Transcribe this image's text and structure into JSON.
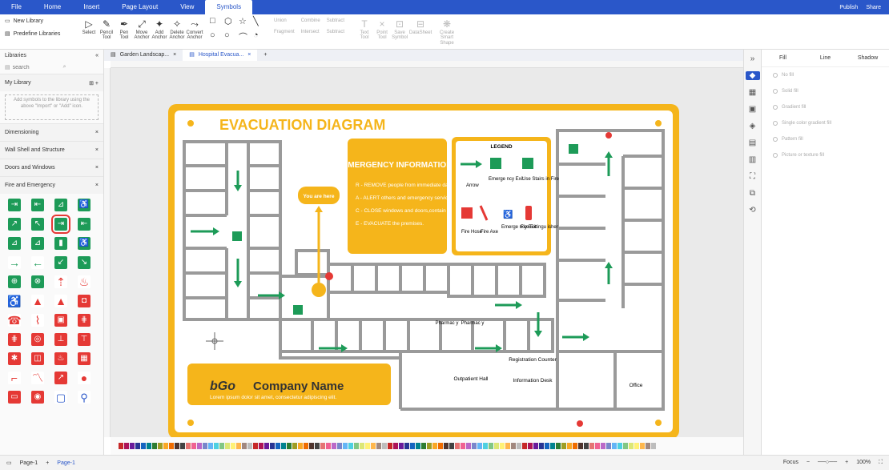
{
  "menubar": {
    "items": [
      "File",
      "Home",
      "Insert",
      "Page Layout",
      "View",
      "Symbols"
    ],
    "publish": "Publish",
    "share": "Share"
  },
  "ribbon": {
    "new_library": "New Library",
    "predefine": "Predefine Libraries",
    "tools": [
      {
        "icon": "▷",
        "label": "Select"
      },
      {
        "icon": "✎",
        "label": "Pencil Tool"
      },
      {
        "icon": "✒",
        "label": "Pen Tool"
      },
      {
        "icon": "⤢",
        "label": "Move Anchor"
      },
      {
        "icon": "✦",
        "label": "Add Anchor"
      },
      {
        "icon": "✧",
        "label": "Delete Anchor"
      },
      {
        "icon": "⤳",
        "label": "Convert Anchor"
      }
    ],
    "shapes": [
      "□",
      "⬡",
      "☆",
      "╲",
      "○",
      "○",
      "⌒",
      "◔"
    ],
    "union": "Union",
    "combine": "Combine",
    "subtract": "Subtract",
    "fragment": "Fragment",
    "intersect": "Intersect",
    "subtract2": "Subtract",
    "tools2": [
      {
        "icon": "T",
        "label": "Text Tool"
      },
      {
        "icon": "×",
        "label": "Point Tool"
      },
      {
        "icon": "⊡",
        "label": "Save Symbol"
      },
      {
        "icon": "⊟",
        "label": "DataSheet"
      },
      {
        "icon": "❋",
        "label": "Create Smart Shape"
      }
    ]
  },
  "sidebar": {
    "title": "Libraries",
    "search_placeholder": "search",
    "my_library": "My Library",
    "empty_hint": "Add symbols to the library using the above \"Import\" or \"Add\" icon.",
    "sections": [
      "Dimensioning",
      "Wall Shell and Structure",
      "Doors and Windows",
      "Fire and Emergency"
    ]
  },
  "tabs": [
    {
      "label": "Garden Landscap..."
    },
    {
      "label": "Hospital Evacua..."
    }
  ],
  "diagram": {
    "title": "EVACUATION DIAGRAM",
    "you_are_here": "You are here",
    "emergency_title": "EMERGENCY INFORMATION",
    "emergency_lines": [
      "R - REMOVE people from immediate danger.",
      "A - ALERT others and emergency services.",
      "C - CLOSE windows and doors,contain the spread of fire.",
      "E - EVACUATE the premises."
    ],
    "legend_title": "LEGEND",
    "legend_items": [
      "Arrow",
      "Emerge ncy Exit",
      "Use Stairs in Fire",
      "Fire Hose",
      "Fire Axe",
      "Emerge ncy Exit",
      "Fire Extingu isher"
    ],
    "company": "Company Name",
    "company_sub": "Lorem ipsum dolor sit amet, consectetur adipiscing elit.",
    "rooms": {
      "pharmacy1": "Pharmac y",
      "pharmacy2": "Pharmac y",
      "registration": "Registration Counter",
      "info": "Information Desk",
      "outpatient": "Outpatient Hall",
      "office": "Office"
    },
    "logo": "bGo"
  },
  "fill_panel": {
    "tabs": [
      "Fill",
      "Line",
      "Shadow"
    ],
    "options": [
      "No fill",
      "Solid fill",
      "Gradient fill",
      "Single color gradient fill",
      "Pattern fill",
      "Picture or texture fill"
    ]
  },
  "status": {
    "page_select": "Page-1",
    "page_tab": "Page-1",
    "focus": "Focus",
    "zoom": "100%"
  },
  "colors": {
    "brand": "#2a57c9",
    "accent": "#f5b51b",
    "exit": "#1d9b58",
    "fire": "#e53935"
  }
}
